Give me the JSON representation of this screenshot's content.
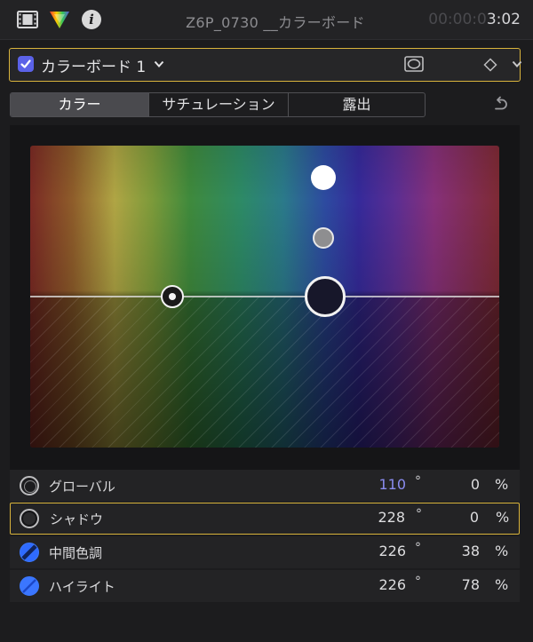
{
  "titlebar": {
    "clip_name": "Z6P_0730 __カラーボード",
    "timecode_dim": "00:00:0",
    "timecode_bright": "3:02",
    "icons": [
      "film-icon",
      "color-inspector-icon",
      "info-icon"
    ]
  },
  "effect": {
    "name": "カラーボード 1",
    "enabled": true,
    "accent_color": "#5b62e8",
    "selection_color": "#d9b43c"
  },
  "tabs": [
    {
      "label": "カラー",
      "active": true
    },
    {
      "label": "サチュレーション",
      "active": false
    },
    {
      "label": "露出",
      "active": false
    }
  ],
  "info_glyph": "i",
  "params": [
    {
      "label": "グローバル",
      "angle": "110",
      "degree": "°",
      "value": "0",
      "unit": "%",
      "highlight_color": "#8a8cf0"
    },
    {
      "label": "シャドウ",
      "angle": "228",
      "degree": "°",
      "value": "0",
      "unit": "%",
      "selected": true
    },
    {
      "label": "中間色調",
      "angle": "226",
      "degree": "°",
      "value": "38",
      "unit": "%"
    },
    {
      "label": "ハイライト",
      "angle": "226",
      "degree": "°",
      "value": "78",
      "unit": "%"
    }
  ]
}
